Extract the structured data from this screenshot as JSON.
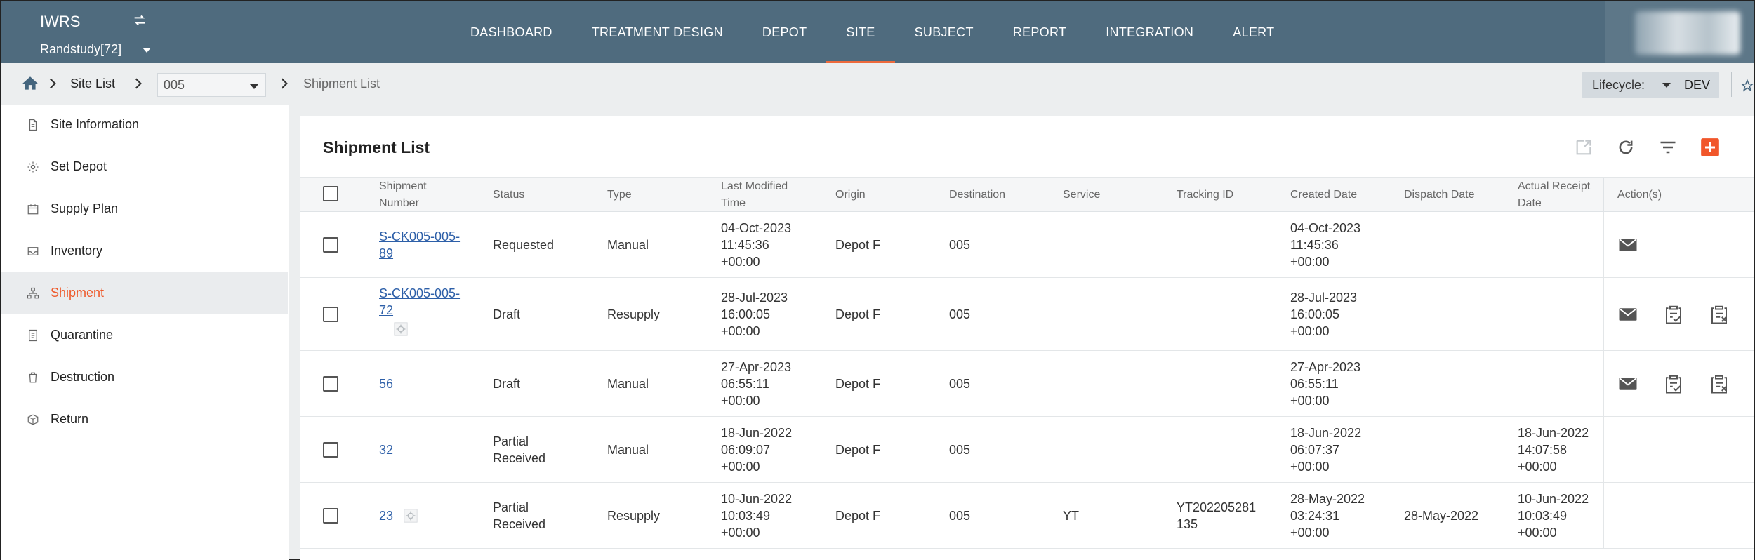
{
  "app": {
    "name": "IWRS",
    "study": "Randstudy[72]"
  },
  "nav": [
    "DASHBOARD",
    "TREATMENT DESIGN",
    "DEPOT",
    "SITE",
    "SUBJECT",
    "REPORT",
    "INTEGRATION",
    "ALERT"
  ],
  "nav_active": "SITE",
  "breadcrumb": {
    "site_list": "Site List",
    "site": "005",
    "current": "Shipment List"
  },
  "lifecycle": {
    "label": "Lifecycle:",
    "value": "DEV"
  },
  "sidebar": {
    "items": [
      {
        "label": "Site Information",
        "icon": "document-icon"
      },
      {
        "label": "Set Depot",
        "icon": "gear-icon"
      },
      {
        "label": "Supply Plan",
        "icon": "calendar-icon"
      },
      {
        "label": "Inventory",
        "icon": "inbox-icon"
      },
      {
        "label": "Shipment",
        "icon": "sitemap-icon"
      },
      {
        "label": "Quarantine",
        "icon": "quarantine-icon"
      },
      {
        "label": "Destruction",
        "icon": "trash-icon"
      },
      {
        "label": "Return",
        "icon": "box-icon"
      }
    ],
    "active": "Shipment"
  },
  "page": {
    "title": "Shipment List"
  },
  "table": {
    "headers": {
      "shipment_number": [
        "Shipment",
        "Number"
      ],
      "status": "Status",
      "type": "Type",
      "last_modified": [
        "Last Modified",
        "Time"
      ],
      "origin": "Origin",
      "destination": "Destination",
      "service": "Service",
      "tracking_id": "Tracking ID",
      "created_date": "Created Date",
      "dispatch_date": "Dispatch Date",
      "actual_receipt": [
        "Actual Receipt",
        "Date"
      ],
      "actions": "Action(s)"
    },
    "rows": [
      {
        "number": [
          "S-CK005-005-",
          "89"
        ],
        "status": [
          "Requested"
        ],
        "type": "Manual",
        "modified": [
          "04-Oct-2023",
          "11:45:36",
          "+00:00"
        ],
        "origin": "Depot F",
        "destination": "005",
        "service": "",
        "tracking": [
          "",
          ""
        ],
        "created": [
          "04-Oct-2023",
          "11:45:36",
          "+00:00"
        ],
        "dispatch": "",
        "receipt": [
          "",
          "",
          ""
        ]
      },
      {
        "number": [
          "S-CK005-005-",
          "72"
        ],
        "status": [
          "Draft"
        ],
        "type": "Resupply",
        "modified": [
          "28-Jul-2023",
          "16:00:05",
          "+00:00"
        ],
        "origin": "Depot F",
        "destination": "005",
        "service": "",
        "tracking": [
          "",
          ""
        ],
        "created": [
          "28-Jul-2023",
          "16:00:05",
          "+00:00"
        ],
        "dispatch": "",
        "receipt": [
          "",
          "",
          ""
        ]
      },
      {
        "number": [
          "56"
        ],
        "status": [
          "Draft"
        ],
        "type": "Manual",
        "modified": [
          "27-Apr-2023",
          "06:55:11",
          "+00:00"
        ],
        "origin": "Depot F",
        "destination": "005",
        "service": "",
        "tracking": [
          "",
          ""
        ],
        "created": [
          "27-Apr-2023",
          "06:55:11",
          "+00:00"
        ],
        "dispatch": "",
        "receipt": [
          "",
          "",
          ""
        ]
      },
      {
        "number": [
          "32"
        ],
        "status": [
          "Partial",
          "Received"
        ],
        "type": "Manual",
        "modified": [
          "18-Jun-2022",
          "06:09:07",
          "+00:00"
        ],
        "origin": "Depot F",
        "destination": "005",
        "service": "",
        "tracking": [
          "",
          ""
        ],
        "created": [
          "18-Jun-2022",
          "06:07:37",
          "+00:00"
        ],
        "dispatch": "",
        "receipt": [
          "18-Jun-2022",
          "14:07:58",
          "+00:00"
        ]
      },
      {
        "number": [
          "23"
        ],
        "status": [
          "Partial",
          "Received"
        ],
        "type": "Resupply",
        "modified": [
          "10-Jun-2022",
          "10:03:49",
          "+00:00"
        ],
        "origin": "Depot F",
        "destination": "005",
        "service": "YT",
        "tracking": [
          "YT202205281",
          "135"
        ],
        "created": [
          "28-May-2022",
          "03:24:31",
          "+00:00"
        ],
        "dispatch": "28-May-2022",
        "receipt": [
          "10-Jun-2022",
          "10:03:49",
          "+00:00"
        ]
      }
    ]
  },
  "colors": {
    "topbar": "#4f6b7e",
    "accent": "#ee5a2b",
    "link": "#2d5fa8"
  }
}
